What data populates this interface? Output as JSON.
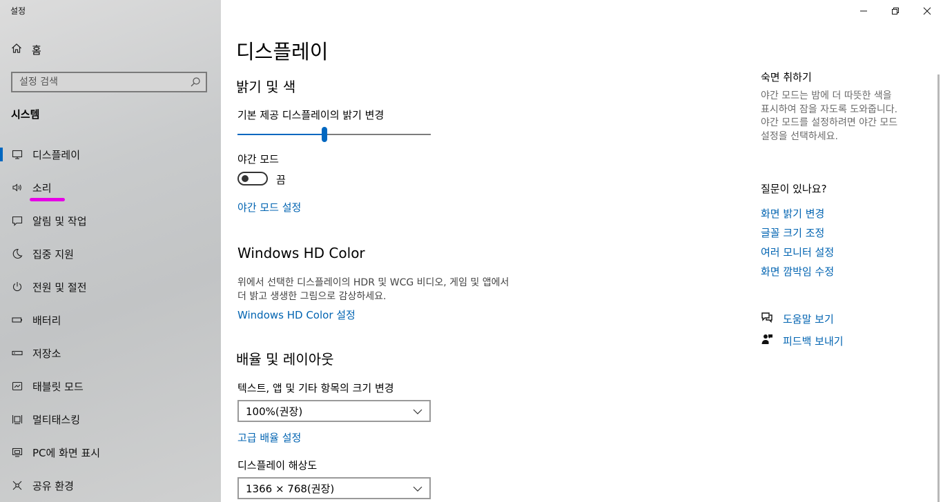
{
  "window": {
    "title": "설정",
    "controls": {
      "minimize": "minimize-icon",
      "restore": "restore-icon",
      "close": "close-icon"
    }
  },
  "sidebar": {
    "home_label": "홈",
    "search_placeholder": "설정 검색",
    "section_title": "시스템",
    "items": [
      {
        "label": "디스플레이",
        "icon": "monitor-icon",
        "active": true
      },
      {
        "label": "소리",
        "icon": "speaker-icon"
      },
      {
        "label": "알림 및 작업",
        "icon": "notification-icon"
      },
      {
        "label": "집중 지원",
        "icon": "moon-icon"
      },
      {
        "label": "전원 및 절전",
        "icon": "power-icon"
      },
      {
        "label": "배터리",
        "icon": "battery-icon"
      },
      {
        "label": "저장소",
        "icon": "storage-icon"
      },
      {
        "label": "태블릿 모드",
        "icon": "tablet-icon"
      },
      {
        "label": "멀티태스킹",
        "icon": "multitasking-icon"
      },
      {
        "label": "PC에 화면 표시",
        "icon": "project-icon"
      },
      {
        "label": "공유 환경",
        "icon": "shared-icon"
      }
    ]
  },
  "main": {
    "title": "디스플레이",
    "brightness": {
      "heading": "밝기 및 색",
      "slider_label": "기본 제공 디스플레이의 밝기 변경",
      "slider_value": 0.45
    },
    "night_light": {
      "label": "야간 모드",
      "state_label": "끔",
      "on": false,
      "settings_link": "야간 모드 설정"
    },
    "hd_color": {
      "heading": "Windows HD Color",
      "description_line1": "위에서 선택한 디스플레이의 HDR 및 WCG 비디오, 게임 및 앱에서",
      "description_line2": "더 밝고 생생한 그림으로 감상하세요.",
      "settings_link": "Windows HD Color 설정"
    },
    "scale_layout": {
      "heading": "배율 및 레이아웃",
      "scale_label": "텍스트, 앱 및 기타 항목의 크기 변경",
      "scale_value": "100%(권장)",
      "advanced_link": "고급 배율 설정",
      "resolution_label": "디스플레이 해상도",
      "resolution_value": "1366 × 768(권장)"
    }
  },
  "right_panel": {
    "sleep_title": "숙면 취하기",
    "sleep_desc_lines": [
      "야간 모드는 밤에 더 따뜻한 색을",
      "표시하여 잠을 자도록 도와줍니다.",
      "야간 모드를 설정하려면 야간 모드",
      "설정을 선택하세요."
    ],
    "question_title": "질문이 있나요?",
    "links": [
      "화면 밝기 변경",
      "글꼴 크기 조정",
      "여러 모니터 설정",
      "화면 깜박임 수정"
    ],
    "help_link": "도움말 보기",
    "feedback_link": "피드백 보내기"
  },
  "colors": {
    "accent": "#0067c0",
    "link": "#0063b1",
    "annotation": "#e600e6"
  }
}
